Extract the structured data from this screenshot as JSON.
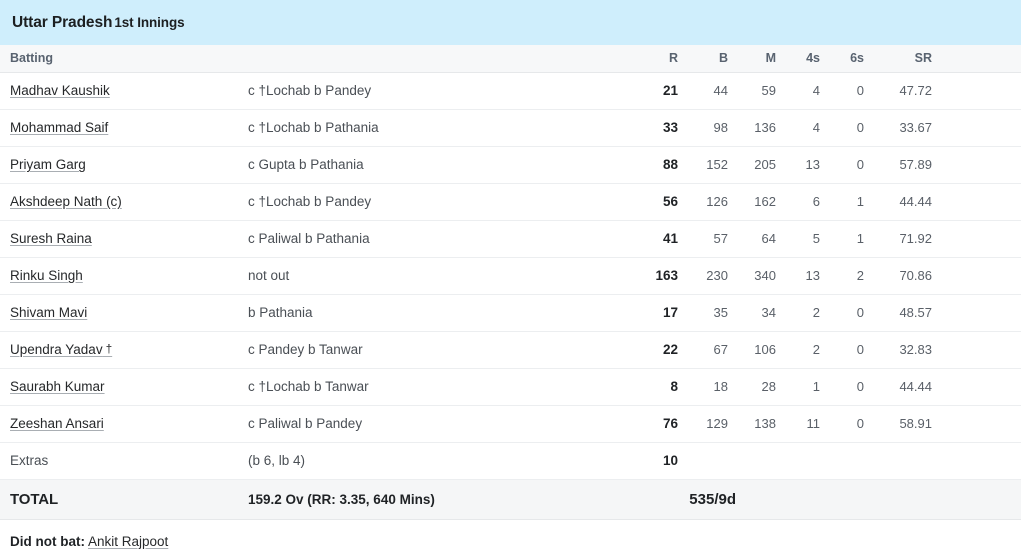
{
  "innings": {
    "team": "Uttar Pradesh",
    "innings_label": "1st Innings",
    "header_bg": "#cfeefc"
  },
  "table": {
    "headers": {
      "batting": "Batting",
      "runs": "R",
      "balls": "B",
      "minutes": "M",
      "fours": "4s",
      "sixes": "6s",
      "strike_rate": "SR"
    },
    "rows": [
      {
        "name": "Madhav Kaushik",
        "role": "",
        "dismissal": "c †Lochab b Pandey",
        "R": "21",
        "B": "44",
        "M": "59",
        "4s": "4",
        "6s": "0",
        "SR": "47.72"
      },
      {
        "name": "Mohammad Saif",
        "role": "",
        "dismissal": "c †Lochab b Pathania",
        "R": "33",
        "B": "98",
        "M": "136",
        "4s": "4",
        "6s": "0",
        "SR": "33.67"
      },
      {
        "name": "Priyam Garg",
        "role": "",
        "dismissal": "c Gupta b Pathania",
        "R": "88",
        "B": "152",
        "M": "205",
        "4s": "13",
        "6s": "0",
        "SR": "57.89"
      },
      {
        "name": "Akshdeep Nath",
        "role": "(c)",
        "dismissal": "c †Lochab b Pandey",
        "R": "56",
        "B": "126",
        "M": "162",
        "4s": "6",
        "6s": "1",
        "SR": "44.44"
      },
      {
        "name": "Suresh Raina",
        "role": "",
        "dismissal": "c Paliwal b Pathania",
        "R": "41",
        "B": "57",
        "M": "64",
        "4s": "5",
        "6s": "1",
        "SR": "71.92"
      },
      {
        "name": "Rinku Singh",
        "role": "",
        "dismissal": "not out",
        "R": "163",
        "B": "230",
        "M": "340",
        "4s": "13",
        "6s": "2",
        "SR": "70.86"
      },
      {
        "name": "Shivam Mavi",
        "role": "",
        "dismissal": "b Pathania",
        "R": "17",
        "B": "35",
        "M": "34",
        "4s": "2",
        "6s": "0",
        "SR": "48.57"
      },
      {
        "name": "Upendra Yadav",
        "role": "†",
        "dismissal": "c Pandey b Tanwar",
        "R": "22",
        "B": "67",
        "M": "106",
        "4s": "2",
        "6s": "0",
        "SR": "32.83"
      },
      {
        "name": "Saurabh Kumar",
        "role": "",
        "dismissal": "c †Lochab b Tanwar",
        "R": "8",
        "B": "18",
        "M": "28",
        "4s": "1",
        "6s": "0",
        "SR": "44.44"
      },
      {
        "name": "Zeeshan Ansari",
        "role": "",
        "dismissal": "c Paliwal b Pandey",
        "R": "76",
        "B": "129",
        "M": "138",
        "4s": "11",
        "6s": "0",
        "SR": "58.91"
      }
    ],
    "extras": {
      "label": "Extras",
      "detail": "(b 6, lb 4)",
      "value": "10"
    },
    "total": {
      "label": "TOTAL",
      "detail": "159.2 Ov (RR: 3.35, 640 Mins)",
      "score": "535/9d"
    }
  },
  "did_not_bat": {
    "label": "Did not bat:",
    "players": [
      "Ankit Rajpoot"
    ]
  }
}
